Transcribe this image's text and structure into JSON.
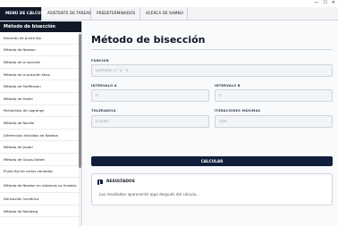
{
  "window": {
    "controls": [
      "—",
      "☐",
      "✕"
    ]
  },
  "tabs": [
    {
      "label": "MENÚ DE CÁLCULO",
      "active": true
    },
    {
      "label": "ASISTENTE DE TAREAS",
      "active": false
    },
    {
      "label": "PREDETERMINADOS",
      "active": false
    },
    {
      "label": "ACERCA DE SAMNU",
      "active": false
    }
  ],
  "sidebar": {
    "header": "Método de bisección",
    "items": [
      "Iteración de punto fijo",
      "Método de Newton",
      "Método de la secante",
      "Método de la posición falsa",
      "Método de Steffensen",
      "Método de Muller",
      "Polinomios de Lagrange",
      "Método de Neville",
      "Diferencias divididas de Newton",
      "Método de Jacobi",
      "Método de Gauss-Seidel",
      "Punto fijo de varias variables",
      "Método de Newton en sistemas no lineales",
      "Derivación numérica",
      "Método de Romberg"
    ]
  },
  "main": {
    "title": "Método de bisección",
    "funcion": {
      "label": "FUNCIÓN",
      "placeholder": "Ejemplo: x^2 - 4"
    },
    "intervalo_a": {
      "label": "INTERVALO A",
      "placeholder": "0"
    },
    "intervalo_b": {
      "label": "INTERVALO B",
      "placeholder": "5"
    },
    "tolerancia": {
      "label": "TOLERANCIA",
      "placeholder": "0.0001"
    },
    "iteraciones": {
      "label": "ITERACIONES MÁXIMAS",
      "placeholder": "100"
    },
    "calcular_label": "CALCULAR",
    "resultados": {
      "title": "RESULTADOS",
      "text": "Los resultados aparecerán aquí después del cálculo..."
    }
  },
  "colors": {
    "dark": "#111827",
    "accent": "#111f3d",
    "field_bg": "#f3f4f6"
  }
}
